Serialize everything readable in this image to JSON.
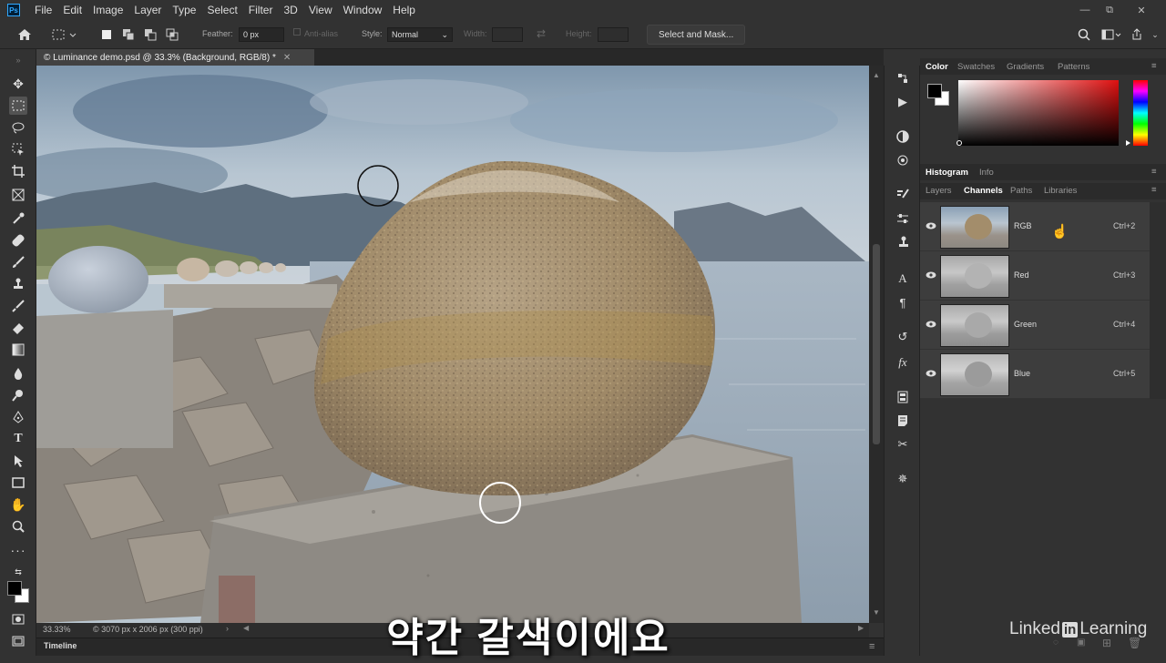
{
  "app": {
    "logo": "Ps"
  },
  "menu": [
    "File",
    "Edit",
    "Image",
    "Layer",
    "Type",
    "Select",
    "Filter",
    "3D",
    "View",
    "Window",
    "Help"
  ],
  "window_controls": {
    "minimize": "—",
    "restore": "⧉",
    "close": "✕"
  },
  "options": {
    "feather_label": "Feather:",
    "feather_value": "0 px",
    "antialias_label": "Anti-alias",
    "style_label": "Style:",
    "style_value": "Normal",
    "width_label": "Width:",
    "height_label": "Height:",
    "select_mask_label": "Select and Mask..."
  },
  "document": {
    "tab_title": "© Luminance demo.psd @ 33.3% (Background, RGB/8) *",
    "zoom": "33.33%",
    "info": "© 3070 px x 2006 px (300 ppi)"
  },
  "timeline_label": "Timeline",
  "panels": {
    "color_tabs": [
      "Color",
      "Swatches",
      "Gradients",
      "Patterns"
    ],
    "mid_tabs": [
      "Histogram",
      "Info"
    ],
    "layer_tabs": [
      "Layers",
      "Channels",
      "Paths",
      "Libraries"
    ],
    "channels": [
      {
        "name": "RGB",
        "shortcut": "Ctrl+2"
      },
      {
        "name": "Red",
        "shortcut": "Ctrl+3"
      },
      {
        "name": "Green",
        "shortcut": "Ctrl+4"
      },
      {
        "name": "Blue",
        "shortcut": "Ctrl+5"
      }
    ]
  },
  "caption": "약간 갈색이에요",
  "brand": {
    "prefix": "Linked",
    "mark": "in",
    "suffix": "Learning"
  },
  "colors": {
    "accent": "#31a8ff",
    "ui_bg": "#323232",
    "panel_row": "#3d3d3d"
  }
}
